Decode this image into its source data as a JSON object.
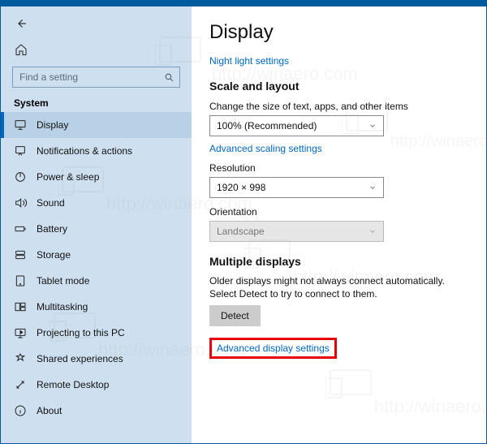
{
  "watermark_text": "http://winaero.com",
  "sidebar": {
    "search_placeholder": "Find a setting",
    "heading": "System",
    "items": [
      {
        "label": "Display"
      },
      {
        "label": "Notifications & actions"
      },
      {
        "label": "Power & sleep"
      },
      {
        "label": "Sound"
      },
      {
        "label": "Battery"
      },
      {
        "label": "Storage"
      },
      {
        "label": "Tablet mode"
      },
      {
        "label": "Multitasking"
      },
      {
        "label": "Projecting to this PC"
      },
      {
        "label": "Shared experiences"
      },
      {
        "label": "Remote Desktop"
      },
      {
        "label": "About"
      }
    ]
  },
  "main": {
    "title": "Display",
    "night_light_link": "Night light settings",
    "scale_heading": "Scale and layout",
    "scale_label": "Change the size of text, apps, and other items",
    "scale_value": "100% (Recommended)",
    "adv_scaling_link": "Advanced scaling settings",
    "resolution_label": "Resolution",
    "resolution_value": "1920 × 998",
    "orientation_label": "Orientation",
    "orientation_value": "Landscape",
    "multi_heading": "Multiple displays",
    "multi_desc": "Older displays might not always connect automatically. Select Detect to try to connect to them.",
    "detect_button": "Detect",
    "adv_display_link": "Advanced display settings"
  }
}
